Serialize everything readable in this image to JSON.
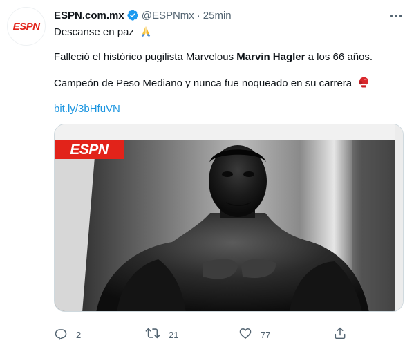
{
  "author": {
    "display_name": "ESPN.com.mx",
    "handle": "@ESPNmx",
    "separator": "·",
    "time": "25min",
    "avatar_text": "ESPN"
  },
  "tweet": {
    "line1": "Descanse en paz",
    "line1_emoji": "folded-hands-emoji",
    "line2_prefix": "Falleció el histórico pugilista Marvelous ",
    "line2_bold": "Marvin Hagler",
    "line2_suffix": " a los 66 años.",
    "line3": "Campeón de Peso Mediano y nunca fue noqueado en su carrera",
    "line3_emoji": "boxing-glove-emoji",
    "link": "bit.ly/3bHfuVN"
  },
  "media": {
    "watermark": "ESPN"
  },
  "actions": {
    "reply_count": "2",
    "retweet_count": "21",
    "like_count": "77"
  },
  "colors": {
    "verified": "#1d9bf0",
    "link": "#1b95e0",
    "brand": "#e2231a",
    "muted": "#536471"
  }
}
